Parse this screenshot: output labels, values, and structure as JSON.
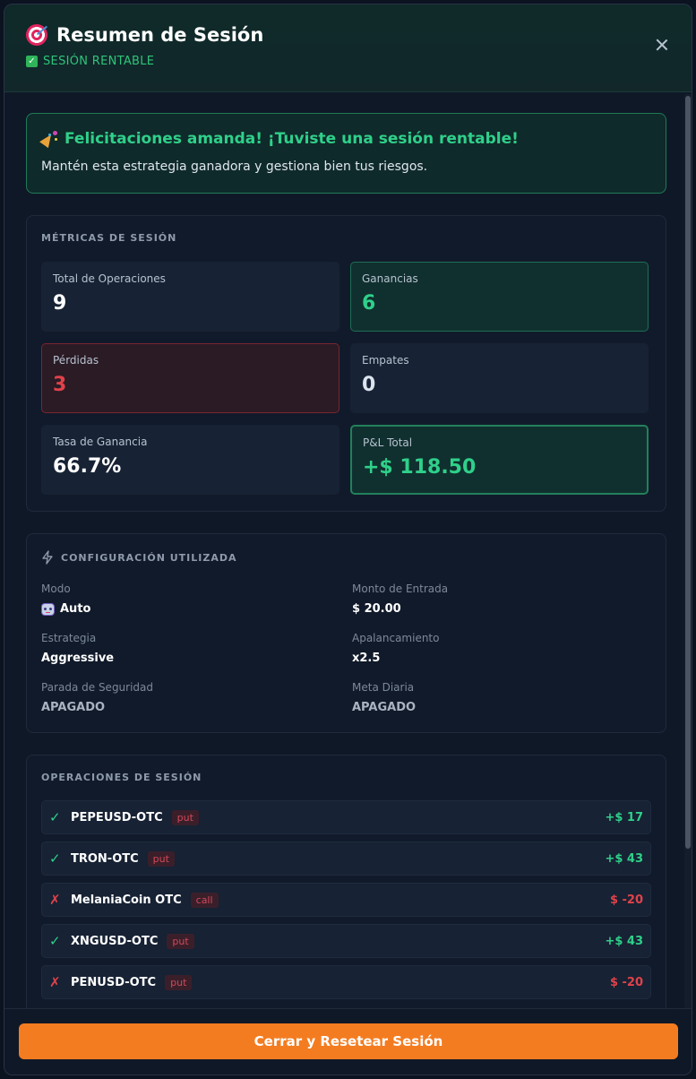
{
  "header": {
    "title": "Resumen de Sesión",
    "status": "SESIÓN RENTABLE",
    "icon": "target-icon",
    "close_icon": "close-icon"
  },
  "congrats": {
    "title": "Felicitaciones amanda! ¡Tuviste una sesión rentable!",
    "message": "Mantén esta estrategia ganadora y gestiona bien tus riesgos."
  },
  "metrics": {
    "title": "MÉTRICAS DE SESIÓN",
    "total_label": "Total de Operaciones",
    "total_value": "9",
    "wins_label": "Ganancias",
    "wins_value": "6",
    "losses_label": "Pérdidas",
    "losses_value": "3",
    "ties_label": "Empates",
    "ties_value": "0",
    "winrate_label": "Tasa de Ganancia",
    "winrate_value": "66.7%",
    "pnl_label": "P&L Total",
    "pnl_value": "+$ 118.50"
  },
  "config": {
    "title": "CONFIGURACIÓN UTILIZADA",
    "mode_label": "Modo",
    "mode_value": "Auto",
    "amount_label": "Monto de Entrada",
    "amount_value": "$ 20.00",
    "strategy_label": "Estrategia",
    "strategy_value": "Aggressive",
    "leverage_label": "Apalancamiento",
    "leverage_value": "x2.5",
    "stop_label": "Parada de Seguridad",
    "stop_value": "APAGADO",
    "goal_label": "Meta Diaria",
    "goal_value": "APAGADO"
  },
  "trades": {
    "title": "OPERACIONES DE SESIÓN",
    "items": [
      {
        "mark": "✓",
        "symbol": "PEPEUSD-OTC",
        "direction": "put",
        "pnl": "+$ 17"
      },
      {
        "mark": "✓",
        "symbol": "TRON-OTC",
        "direction": "put",
        "pnl": "+$ 43"
      },
      {
        "mark": "✗",
        "symbol": "MelaniaCoin OTC",
        "direction": "call",
        "pnl": "$ -20"
      },
      {
        "mark": "✓",
        "symbol": "XNGUSD-OTC",
        "direction": "put",
        "pnl": "+$ 43"
      },
      {
        "mark": "✗",
        "symbol": "PENUSD-OTC",
        "direction": "put",
        "pnl": "$ -20"
      }
    ]
  },
  "footer": {
    "button_label": "Cerrar y Resetear Sesión"
  },
  "colors": {
    "accent": "#f47c20",
    "positive": "#2fd08a",
    "negative": "#e0424a"
  }
}
